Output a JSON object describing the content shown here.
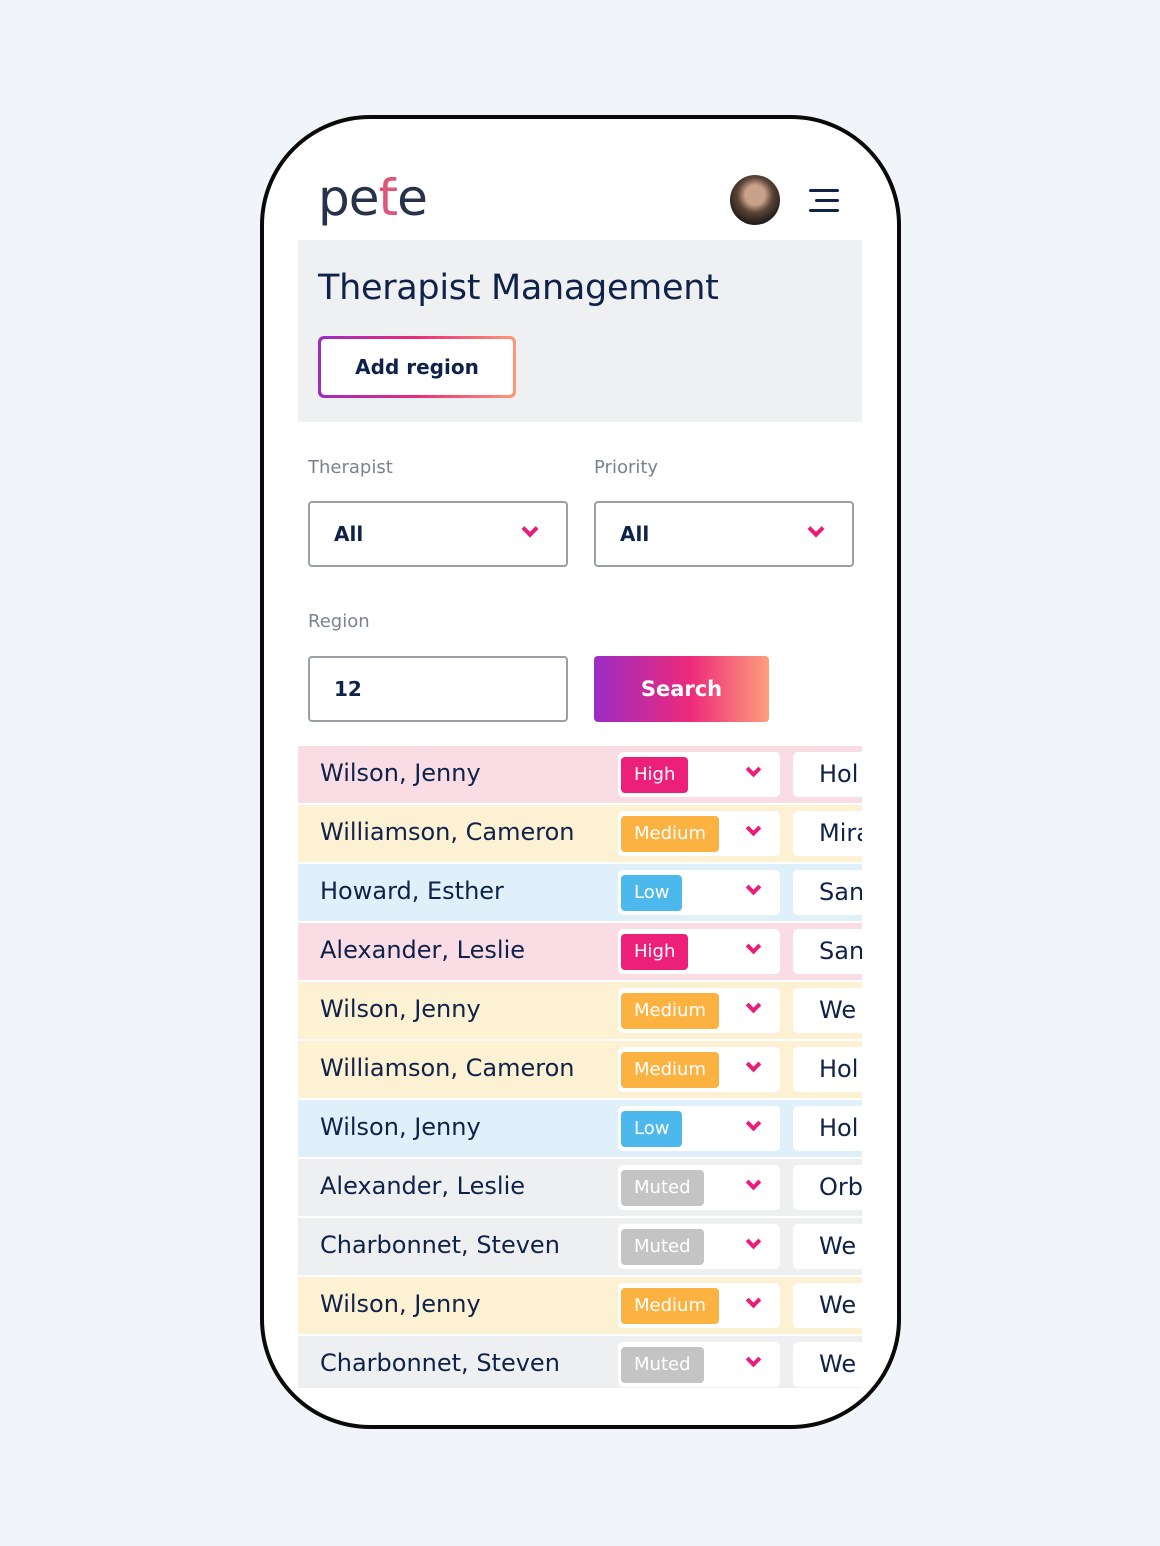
{
  "app": {
    "logo": "pete",
    "menu_icon": "hamburger-icon"
  },
  "header": {
    "title": "Therapist Management",
    "add_region_label": "Add region"
  },
  "filters": {
    "therapist": {
      "label": "Therapist",
      "value": "All"
    },
    "priority": {
      "label": "Priority",
      "value": "All"
    },
    "region": {
      "label": "Region",
      "value": "12"
    },
    "search_label": "Search"
  },
  "colors": {
    "High": {
      "badge": "#ec1f79",
      "row": "#fadde4"
    },
    "Medium": {
      "badge": "#fbb241",
      "row": "#fdf1d4"
    },
    "Low": {
      "badge": "#4db8ec",
      "row": "#dff0fa"
    },
    "Muted": {
      "badge": "#c4c4c4",
      "row": "#eeeff1"
    }
  },
  "rows": [
    {
      "name": "Wilson, Jenny",
      "priority": "High",
      "location": "Hol"
    },
    {
      "name": "Williamson, Cameron",
      "priority": "Medium",
      "location": "Mira"
    },
    {
      "name": "Howard, Esther",
      "priority": "Low",
      "location": "San"
    },
    {
      "name": "Alexander, Leslie",
      "priority": "High",
      "location": "San"
    },
    {
      "name": "Wilson, Jenny",
      "priority": "Medium",
      "location": "We"
    },
    {
      "name": "Williamson, Cameron",
      "priority": "Medium",
      "location": "Hol"
    },
    {
      "name": "Wilson, Jenny",
      "priority": "Low",
      "location": "Hol"
    },
    {
      "name": "Alexander, Leslie",
      "priority": "Muted",
      "location": "Orb"
    },
    {
      "name": "Charbonnet, Steven",
      "priority": "Muted",
      "location": "We"
    },
    {
      "name": "Wilson, Jenny",
      "priority": "Medium",
      "location": "We"
    },
    {
      "name": "Charbonnet, Steven",
      "priority": "Muted",
      "location": "We"
    }
  ]
}
